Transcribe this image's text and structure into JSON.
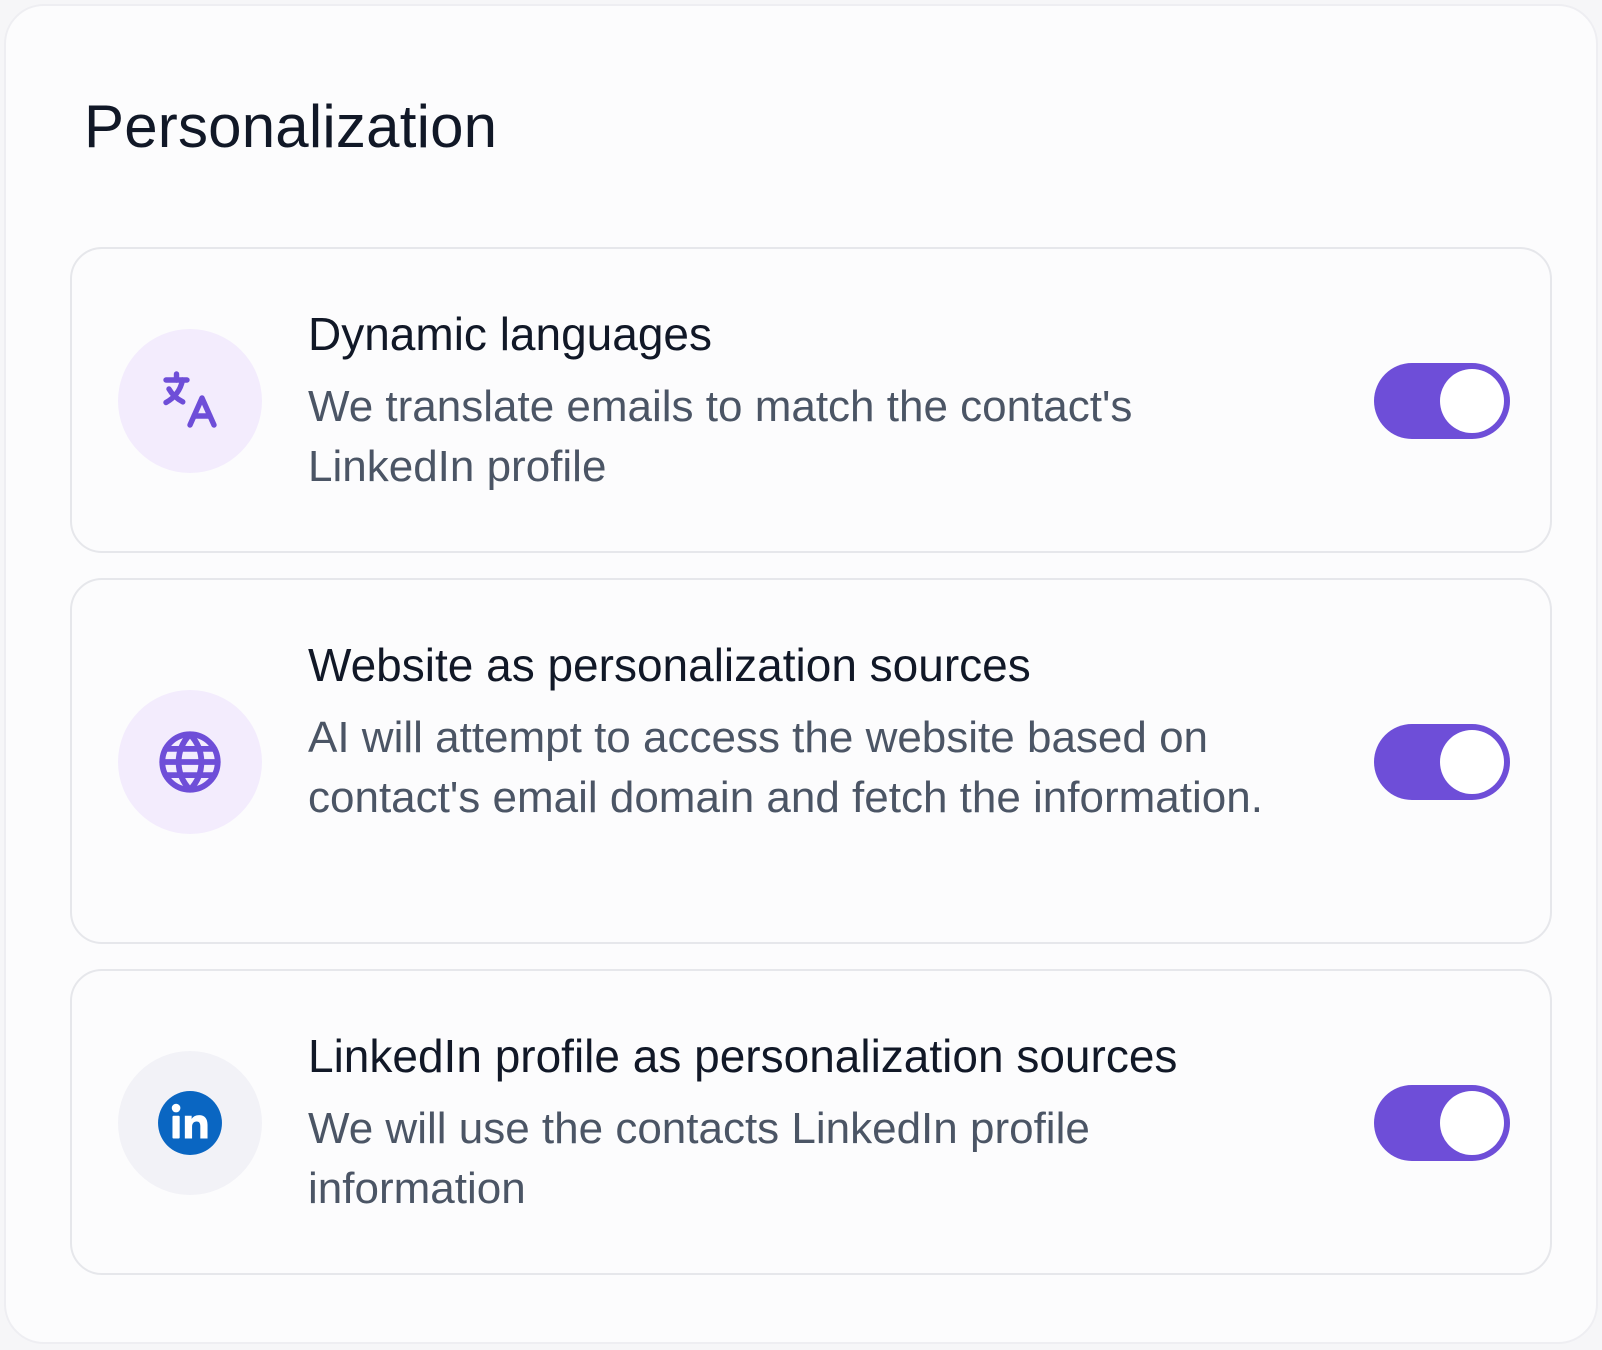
{
  "page": {
    "title": "Personalization"
  },
  "settings": [
    {
      "title": "Dynamic languages",
      "description": "We translate emails to match the contact's LinkedIn profile",
      "icon": "translate-icon",
      "enabled": true
    },
    {
      "title": "Website as personalization sources",
      "description": "AI will attempt to access the website based on contact's email domain and fetch the information.",
      "icon": "globe-icon",
      "enabled": true
    },
    {
      "title": "LinkedIn profile as personalization sources",
      "description": "We will use the contacts LinkedIn profile information",
      "icon": "linkedin-icon",
      "enabled": true
    }
  ],
  "colors": {
    "accent": "#6e4ed8",
    "icon_bg": "#f3ecfd",
    "linkedin_blue": "#0a66c2"
  }
}
